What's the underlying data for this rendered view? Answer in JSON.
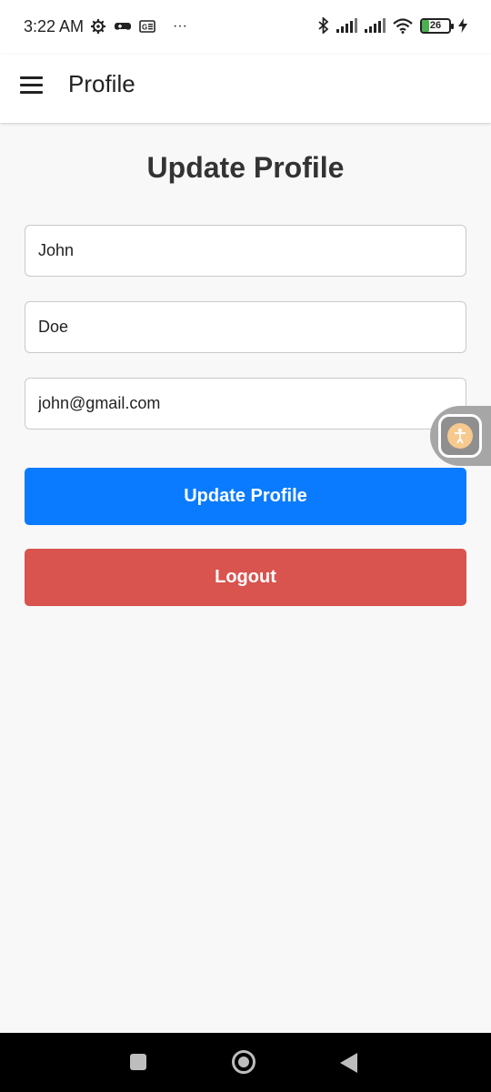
{
  "status_bar": {
    "time": "3:22 AM",
    "more": "···",
    "battery_level": "26",
    "icons": [
      "gear-icon",
      "gamepad-icon",
      "sim-card-icon",
      "bluetooth-icon",
      "signal-icon",
      "wifi-icon",
      "battery-icon",
      "charging-icon"
    ]
  },
  "app_bar": {
    "title": "Profile",
    "menu_icon": "hamburger-menu-icon"
  },
  "page": {
    "heading": "Update Profile"
  },
  "form": {
    "first_name": "John",
    "last_name": "Doe",
    "email": "john@gmail.com",
    "update_label": "Update Profile",
    "logout_label": "Logout"
  },
  "colors": {
    "primary": "#0a7bff",
    "danger": "#d9534f",
    "background": "#f8f8f8"
  },
  "nav_bar": {
    "icons": [
      "recents-icon",
      "home-icon",
      "back-icon"
    ]
  }
}
